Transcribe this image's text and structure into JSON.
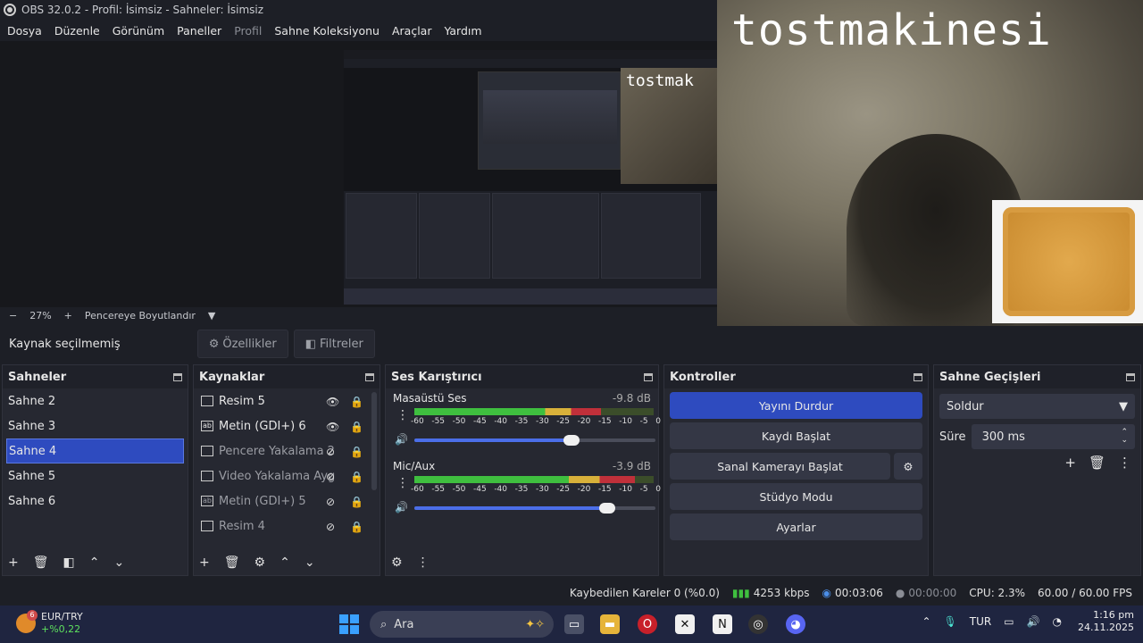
{
  "window": {
    "title": "OBS 32.0.2 - Profil: İsimsiz - Sahneler: İsimsiz"
  },
  "menu": [
    {
      "label": "Dosya",
      "enabled": true
    },
    {
      "label": "Düzenle",
      "enabled": true
    },
    {
      "label": "Görünüm",
      "enabled": true
    },
    {
      "label": "Paneller",
      "enabled": true
    },
    {
      "label": "Profil",
      "enabled": false
    },
    {
      "label": "Sahne Koleksiyonu",
      "enabled": true
    },
    {
      "label": "Araçlar",
      "enabled": true
    },
    {
      "label": "Yardım",
      "enabled": true
    }
  ],
  "webcam": {
    "watermark": "tostmakinesi",
    "nested_watermark": "tostmak"
  },
  "zoom": {
    "minus": "−",
    "value": "27%",
    "plus": "+",
    "fit_label": "Pencereye Boyutlandır"
  },
  "source_bar": {
    "status": "Kaynak seçilmemiş",
    "properties": "Özellikler",
    "filters": "Filtreler"
  },
  "scenes": {
    "title": "Sahneler",
    "items": [
      "Sahne 2",
      "Sahne 3",
      "Sahne 4",
      "Sahne 5",
      "Sahne 6"
    ],
    "selected": "Sahne 4"
  },
  "sources": {
    "title": "Kaynaklar",
    "items": [
      {
        "label": "Resim 5",
        "icon": "image-icon",
        "visible": true
      },
      {
        "label": "Metin (GDI+) 6",
        "icon": "text-icon",
        "visible": true
      },
      {
        "label": "Pencere Yakalama 2",
        "icon": "window-icon",
        "visible": false
      },
      {
        "label": "Video Yakalama Ayg",
        "icon": "camera-icon",
        "visible": false
      },
      {
        "label": "Metin (GDI+) 5",
        "icon": "text-icon",
        "visible": false
      },
      {
        "label": "Resim 4",
        "icon": "image-icon",
        "visible": false
      }
    ]
  },
  "mixer": {
    "title": "Ses Karıştırıcı",
    "ticks": [
      "-60",
      "-55",
      "-50",
      "-45",
      "-40",
      "-35",
      "-30",
      "-25",
      "-20",
      "-15",
      "-10",
      "-5",
      "0"
    ],
    "channels": [
      {
        "name": "Masaüstü Ses",
        "db": "-9.8 dB",
        "level": 0.78,
        "volume": 0.65
      },
      {
        "name": "Mic/Aux",
        "db": "-3.9 dB",
        "level": 0.92,
        "volume": 0.8
      }
    ]
  },
  "controls": {
    "title": "Kontroller",
    "stop_stream": "Yayını Durdur",
    "start_record": "Kaydı Başlat",
    "virtual_cam": "Sanal Kamerayı Başlat",
    "studio_mode": "Stüdyo Modu",
    "settings": "Ayarlar"
  },
  "transitions": {
    "title": "Sahne Geçişleri",
    "selected": "Soldur",
    "duration_label": "Süre",
    "duration_value": "300 ms"
  },
  "status": {
    "dropped": "Kaybedilen Kareler 0 (%0.0)",
    "bitrate": "4253 kbps",
    "stream_time": "00:03:06",
    "record_time": "00:00:00",
    "cpu": "CPU: 2.3%",
    "fps": "60.00 / 60.00 FPS"
  },
  "taskbar": {
    "ticker": "EUR/TRY",
    "change": "+%0,22",
    "badge": "6",
    "search": "Ara",
    "lang": "TUR",
    "time": "1:16 pm",
    "date": "24.11.2025"
  },
  "colors": {
    "accent": "#2e4bbf",
    "panel": "#262831",
    "background": "#1d1f26",
    "meter_green": "#3fbf3f",
    "meter_yellow": "#d8b13a",
    "meter_red": "#c0303a"
  }
}
